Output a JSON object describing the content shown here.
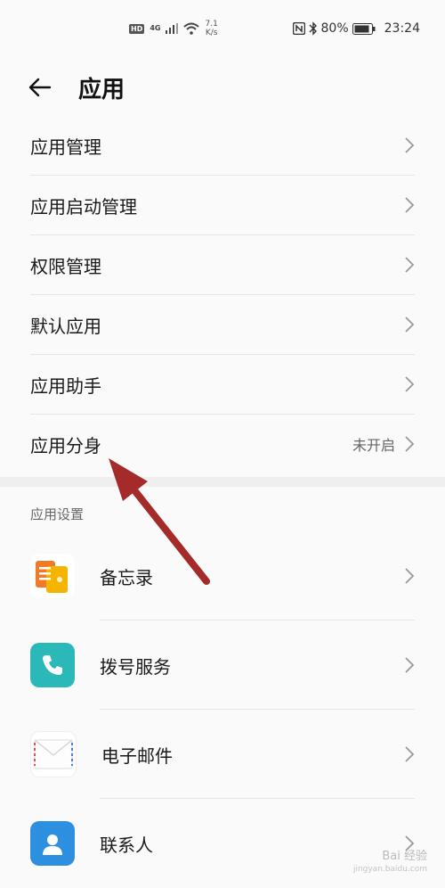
{
  "status_bar": {
    "hd": "HD",
    "network": "4G",
    "speed_value": "7.1",
    "speed_unit": "K/s",
    "battery": "80%",
    "time": "23:24",
    "icons": [
      "signal-icon",
      "wifi-icon",
      "nfc-icon",
      "bluetooth-icon",
      "battery-icon"
    ]
  },
  "header": {
    "title": "应用"
  },
  "menu": [
    {
      "label": "应用管理",
      "value": ""
    },
    {
      "label": "应用启动管理",
      "value": ""
    },
    {
      "label": "权限管理",
      "value": ""
    },
    {
      "label": "默认应用",
      "value": ""
    },
    {
      "label": "应用助手",
      "value": ""
    },
    {
      "label": "应用分身",
      "value": "未开启"
    }
  ],
  "app_settings": {
    "section_title": "应用设置",
    "items": [
      {
        "label": "备忘录",
        "icon": "notepad-icon"
      },
      {
        "label": "拨号服务",
        "icon": "phone-icon"
      },
      {
        "label": "电子邮件",
        "icon": "email-icon"
      },
      {
        "label": "联系人",
        "icon": "contacts-icon"
      }
    ]
  },
  "watermark": {
    "brand": "Bai 经验",
    "url": "jingyan.baidu.com"
  },
  "colors": {
    "arrow": "#a52a2a",
    "phone_teal": "#2bb8b8",
    "contacts_blue": "#2d8fe0",
    "notepad_orange": "#f08a2a"
  }
}
